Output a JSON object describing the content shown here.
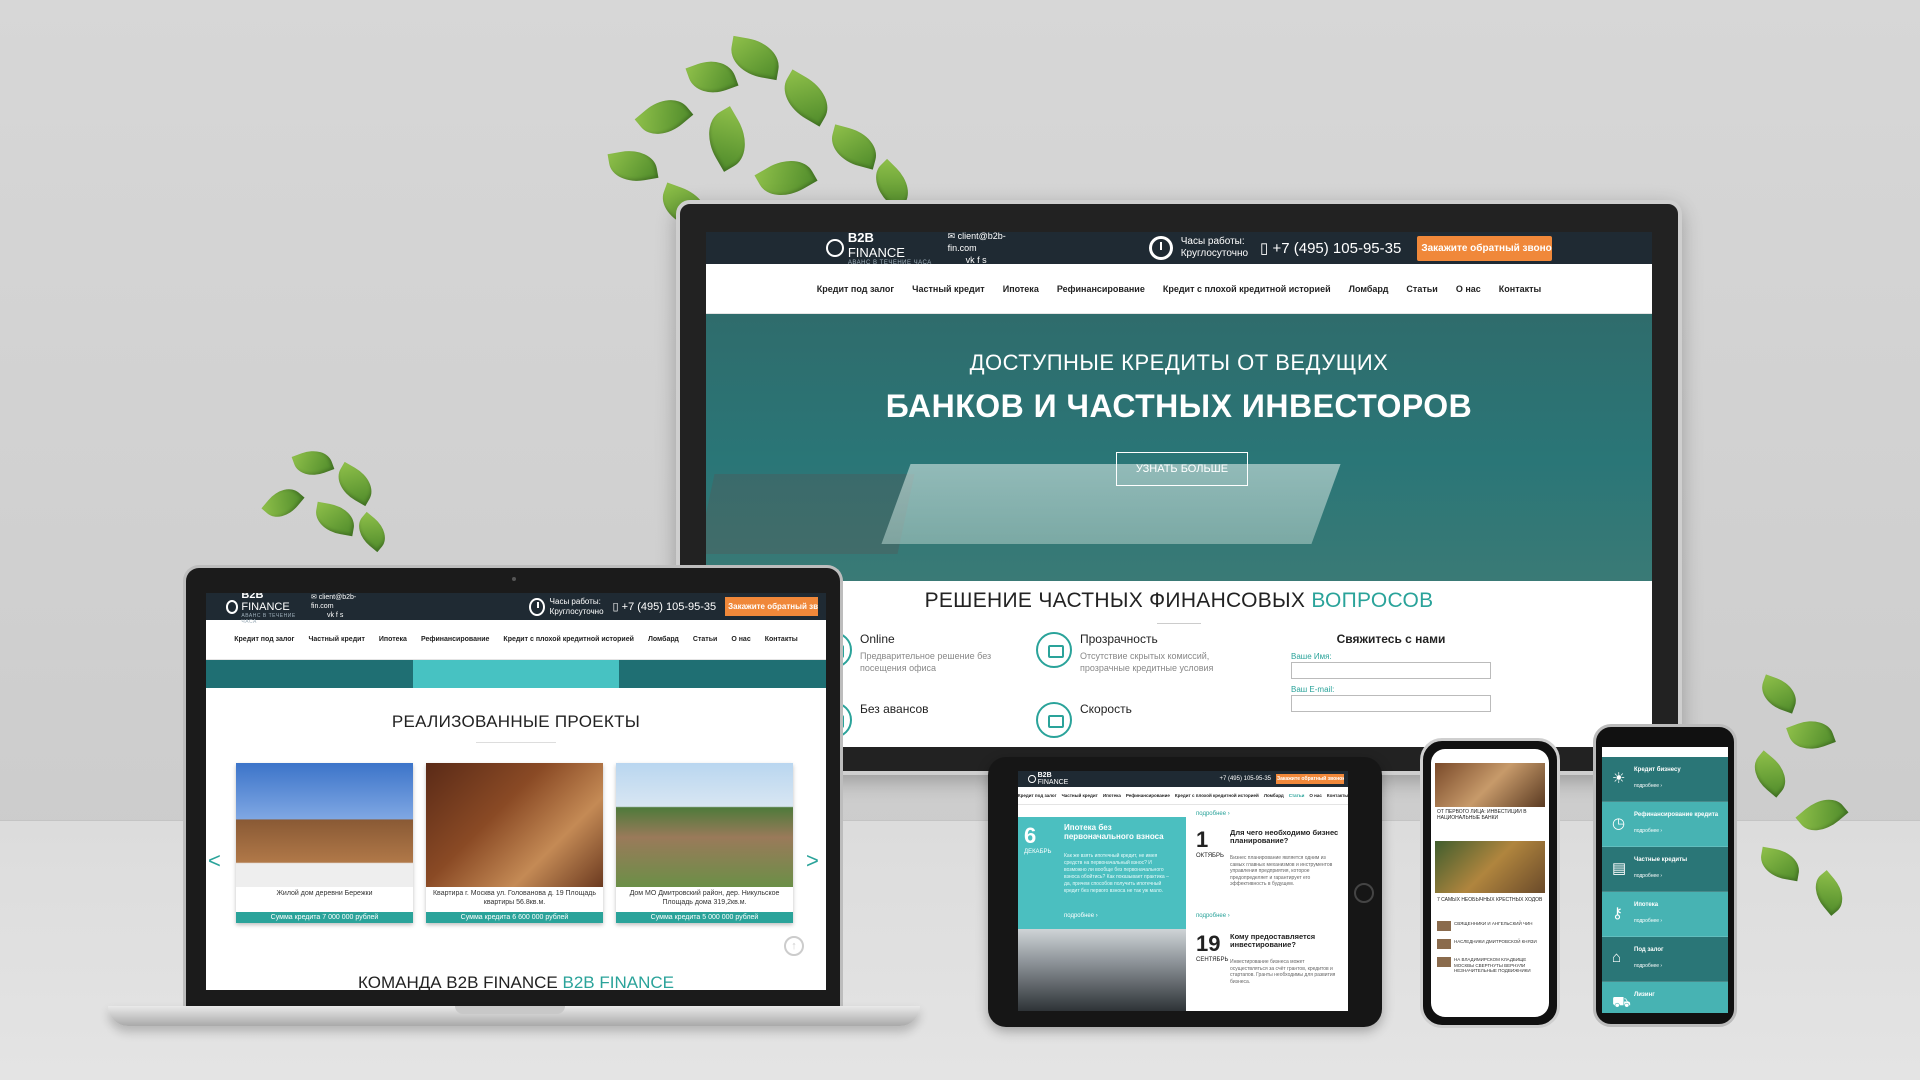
{
  "brand": {
    "logo_bold": "B2B",
    "logo_rest": " FINANCE",
    "tagline": "АВАНС В ТЕЧЕНИЕ ЧАСА"
  },
  "contact": {
    "email": "client@b2b-fin.com",
    "hours_label": "Часы работы:",
    "hours_value": "Круглосуточно",
    "phone": "+7 (495) 105-95-35",
    "callback_button": "Закажите обратный звонок"
  },
  "nav": [
    "Кредит под залог",
    "Частный кредит",
    "Ипотека",
    "Рефинансирование",
    "Кредит с плохой кредитной историей",
    "Ломбард",
    "Статьи",
    "О нас",
    "Контакты"
  ],
  "monitor": {
    "hero_line1": "ДОСТУПНЫЕ КРЕДИТЫ ОТ ВЕДУЩИХ",
    "hero_line2": "БАНКОВ И ЧАСТНЫХ ИНВЕСТОРОВ",
    "hero_button": "УЗНАТЬ БОЛЬШЕ",
    "section_title_main": "РЕШЕНИЕ ЧАСТНЫХ ФИНАНСОВЫХ ",
    "section_title_accent": "ВОПРОСОВ",
    "features": [
      {
        "title": "Online",
        "text": "Предварительное решение без посещения офиса"
      },
      {
        "title": "Прозрачность",
        "text": "Отсутствие скрытых комиссий, прозрачные кредитные условия"
      },
      {
        "title": "Без авансов",
        "text": ""
      },
      {
        "title": "Скорость",
        "text": ""
      }
    ],
    "contact_form": {
      "title": "Свяжитесь с нами",
      "name_label": "Ваше Имя:",
      "email_label": "Ваш E-mail:"
    }
  },
  "laptop": {
    "section_title": "РЕАЛИЗОВАННЫЕ ПРОЕКТЫ",
    "prev_arrow": "<",
    "next_arrow": ">",
    "cards": [
      {
        "caption": "Жилой дом деревни Бережки",
        "sum": "Сумма кредита 7 000 000 рублей"
      },
      {
        "caption": "Квартира г. Москва ул. Голованова д. 19 Площадь квартиры 56.8кв.м.",
        "sum": "Сумма кредита 6 600 000 рублей"
      },
      {
        "caption": "Дом МО Дмитровский район, дер. Никульское Площадь дома 319,2кв.м.",
        "sum": "Сумма кредита 5 000 000 рублей"
      }
    ],
    "team_title_main": "КОМАНДА B2B FINANCE ",
    "team_title_accent": "B2B FINANCE"
  },
  "tablet": {
    "more_top": "подробнее ›",
    "post1": {
      "day": "6",
      "month": "ДЕКАБРЬ",
      "title": "Ипотека без первоначального взноса",
      "text": "Как же взять ипотечный кредит, не имея средств на первоначальный взнос? И возможно ли вообще без первоначального взноса обойтись? Как показывает практика – да, причем способов получить ипотечный кредит без первого взноса не так уж мало.",
      "more": "подробнее ›"
    },
    "post2": {
      "day": "1",
      "month": "ОКТЯБРЬ",
      "title": "Для чего необходимо бизнес планирование?",
      "text": "Бизнес планирование является одним из самых главных механизмов и инструментов управления предприятия, которое предопределяет и гарантирует его эффективность в будущем.",
      "more": "подробнее ›"
    },
    "post3": {
      "day": "19",
      "month": "СЕНТЯБРЬ",
      "title": "Кому предоставляется инвестирование?",
      "text": "Инвестирование бизнеса может осуществляться за счёт грантов, кредитов и стартапов. Гранты необходимы для развития бизнеса."
    }
  },
  "phone1": {
    "cap1": "ОТ ПЕРВОГО ЛИЦА: ИНВЕСТИЦИИ В НАЦИОНАЛЬНЫЕ БАНКИ",
    "cap2": "7 САМЫХ НЕОБЫЧНЫХ КРЕСТНЫХ ХОДОВ",
    "items": [
      "СВЯЩЕННИКИ И АНГЕЛЬСКИЙ ЧИН",
      "НАСЛЕДНИКИ ДМИТРОВСКОЙ КНЯЗИ",
      "НА ВЛАДИМИРСКОМ КЛАДБИЩЕ МОСКВЫ СВЕРГНУТЫ ВЕРНУЛИ НЕЗНАЧИТЕЛЬНЫЕ ПОДВИЖНИКИ"
    ]
  },
  "phone2": {
    "items": [
      {
        "icon": "bulb",
        "title": "Кредит бизнесу",
        "more": "подробнее ›"
      },
      {
        "icon": "clock",
        "title": "Рефинансирование кредита",
        "more": "подробнее ›"
      },
      {
        "icon": "coins",
        "title": "Частные кредиты",
        "more": "подробнее ›"
      },
      {
        "icon": "key",
        "title": "Ипотека",
        "more": "подробнее ›"
      },
      {
        "icon": "house",
        "title": "Под залог",
        "more": "подробнее ›"
      },
      {
        "icon": "car",
        "title": "Лизинг",
        "more": ""
      }
    ]
  },
  "colors": {
    "teal": "#2aa39a",
    "dark_header": "#1f2a33",
    "orange": "#f0883a"
  }
}
